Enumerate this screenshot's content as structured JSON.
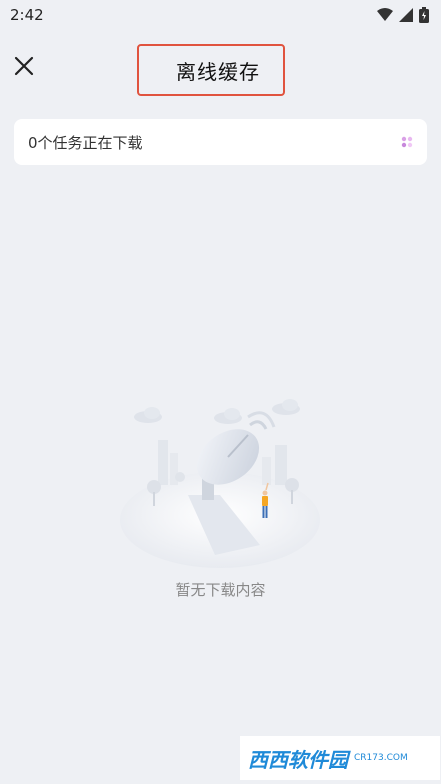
{
  "status_bar": {
    "time": "2:42"
  },
  "header": {
    "title": "离线缓存"
  },
  "task": {
    "text": "0个任务正在下载"
  },
  "empty_state": {
    "text": "暂无下载内容"
  },
  "watermark": {
    "logo_text": "西西软件园",
    "sub_text": "CR173.COM"
  },
  "colors": {
    "background": "#eef0f4",
    "highlight_border": "#e0533e",
    "watermark": "#1f8ad8"
  }
}
